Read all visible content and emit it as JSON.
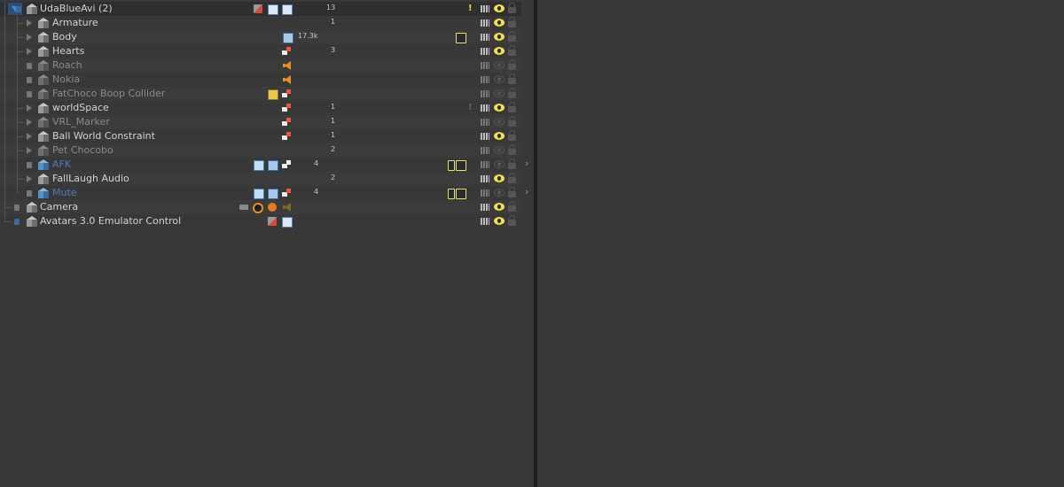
{
  "hierarchy": {
    "rows": [
      {
        "label": "UdaBlueAvi (2)",
        "count": "13",
        "warn": "!",
        "eye": true
      },
      {
        "label": "Armature",
        "count": "1",
        "eye": true
      },
      {
        "label": "Body",
        "tris": "17.3k",
        "eye": true
      },
      {
        "label": "Hearts",
        "count": "3",
        "eye": true
      },
      {
        "label": "Roach",
        "eye": false
      },
      {
        "label": "Nokia",
        "eye": false
      },
      {
        "label": "FatChoco Boop Collider",
        "eye": false
      },
      {
        "label": "worldSpace",
        "count": "1",
        "warn": "!",
        "eye": true
      },
      {
        "label": "VRL_Marker",
        "count": "1",
        "eye": false
      },
      {
        "label": "Ball World Constraint",
        "count": "1",
        "eye": true
      },
      {
        "label": "Pet Chocobo",
        "count": "2",
        "eye": false
      },
      {
        "label": "AFK",
        "count": "4",
        "eye": false
      },
      {
        "label": "FallLaugh Audio",
        "count": "2",
        "eye": true
      },
      {
        "label": "Mute",
        "count": "4",
        "eye": false
      },
      {
        "label": "Camera",
        "eye": true
      },
      {
        "label": "Avatars 3.0 Emulator Control",
        "eye": true
      }
    ]
  },
  "colors": {
    "background": "#383838",
    "eye": "#f0e040",
    "prefab_blue": "#4a7cb8",
    "warning": "#f0d840"
  }
}
